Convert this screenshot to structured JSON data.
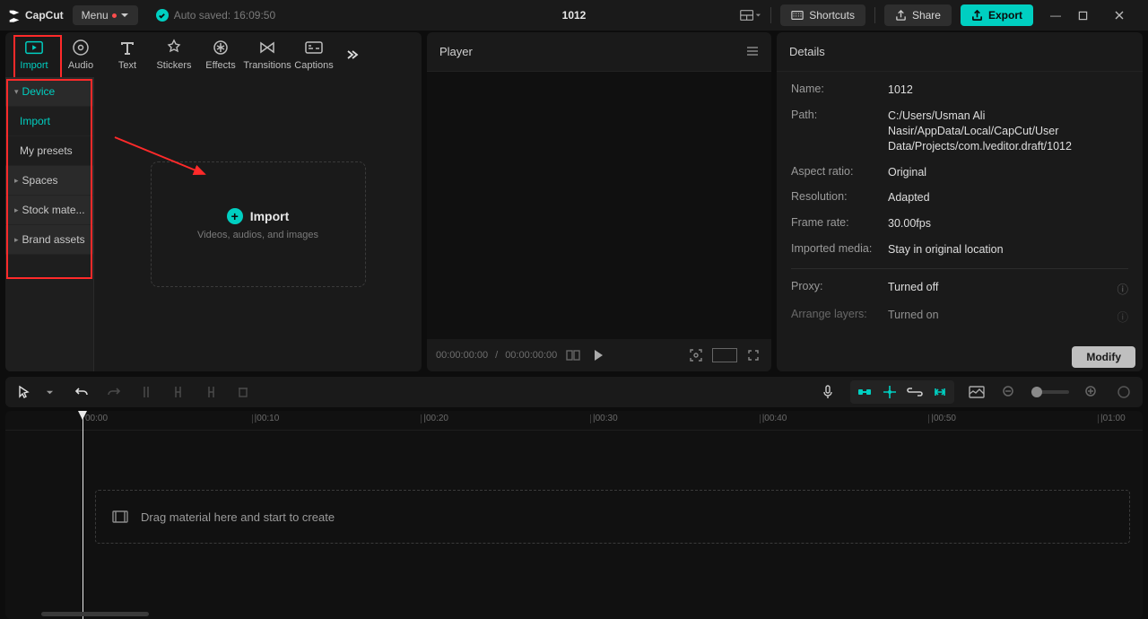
{
  "app": {
    "name": "CapCut",
    "menu_label": "Menu",
    "autosave": "Auto saved: 16:09:50",
    "project_name": "1012"
  },
  "title_buttons": {
    "shortcuts": "Shortcuts",
    "share": "Share",
    "export": "Export"
  },
  "media_tabs": {
    "import": "Import",
    "audio": "Audio",
    "text": "Text",
    "stickers": "Stickers",
    "effects": "Effects",
    "transitions": "Transitions",
    "captions": "Captions"
  },
  "side_panel": {
    "device": "Device",
    "import": "Import",
    "my_presets": "My presets",
    "spaces": "Spaces",
    "stock": "Stock mate...",
    "brand": "Brand assets"
  },
  "import_box": {
    "title": "Import",
    "subtitle": "Videos, audios, and images"
  },
  "player": {
    "title": "Player",
    "time_current": "00:00:00:00",
    "time_total": "00:00:00:00"
  },
  "details": {
    "title": "Details",
    "name_label": "Name:",
    "name_value": "1012",
    "path_label": "Path:",
    "path_value": "C:/Users/Usman Ali Nasir/AppData/Local/CapCut/User Data/Projects/com.lveditor.draft/1012",
    "aspect_label": "Aspect ratio:",
    "aspect_value": "Original",
    "resolution_label": "Resolution:",
    "resolution_value": "Adapted",
    "framerate_label": "Frame rate:",
    "framerate_value": "30.00fps",
    "imported_label": "Imported media:",
    "imported_value": "Stay in original location",
    "proxy_label": "Proxy:",
    "proxy_value": "Turned off",
    "arrange_label": "Arrange layers:",
    "arrange_value": "Turned on",
    "modify": "Modify"
  },
  "timeline": {
    "drop_hint": "Drag material here and start to create",
    "ticks": [
      "00:00",
      "|00:10",
      "|00:20",
      "|00:30",
      "|00:40",
      "|00:50",
      "|01:00"
    ]
  }
}
